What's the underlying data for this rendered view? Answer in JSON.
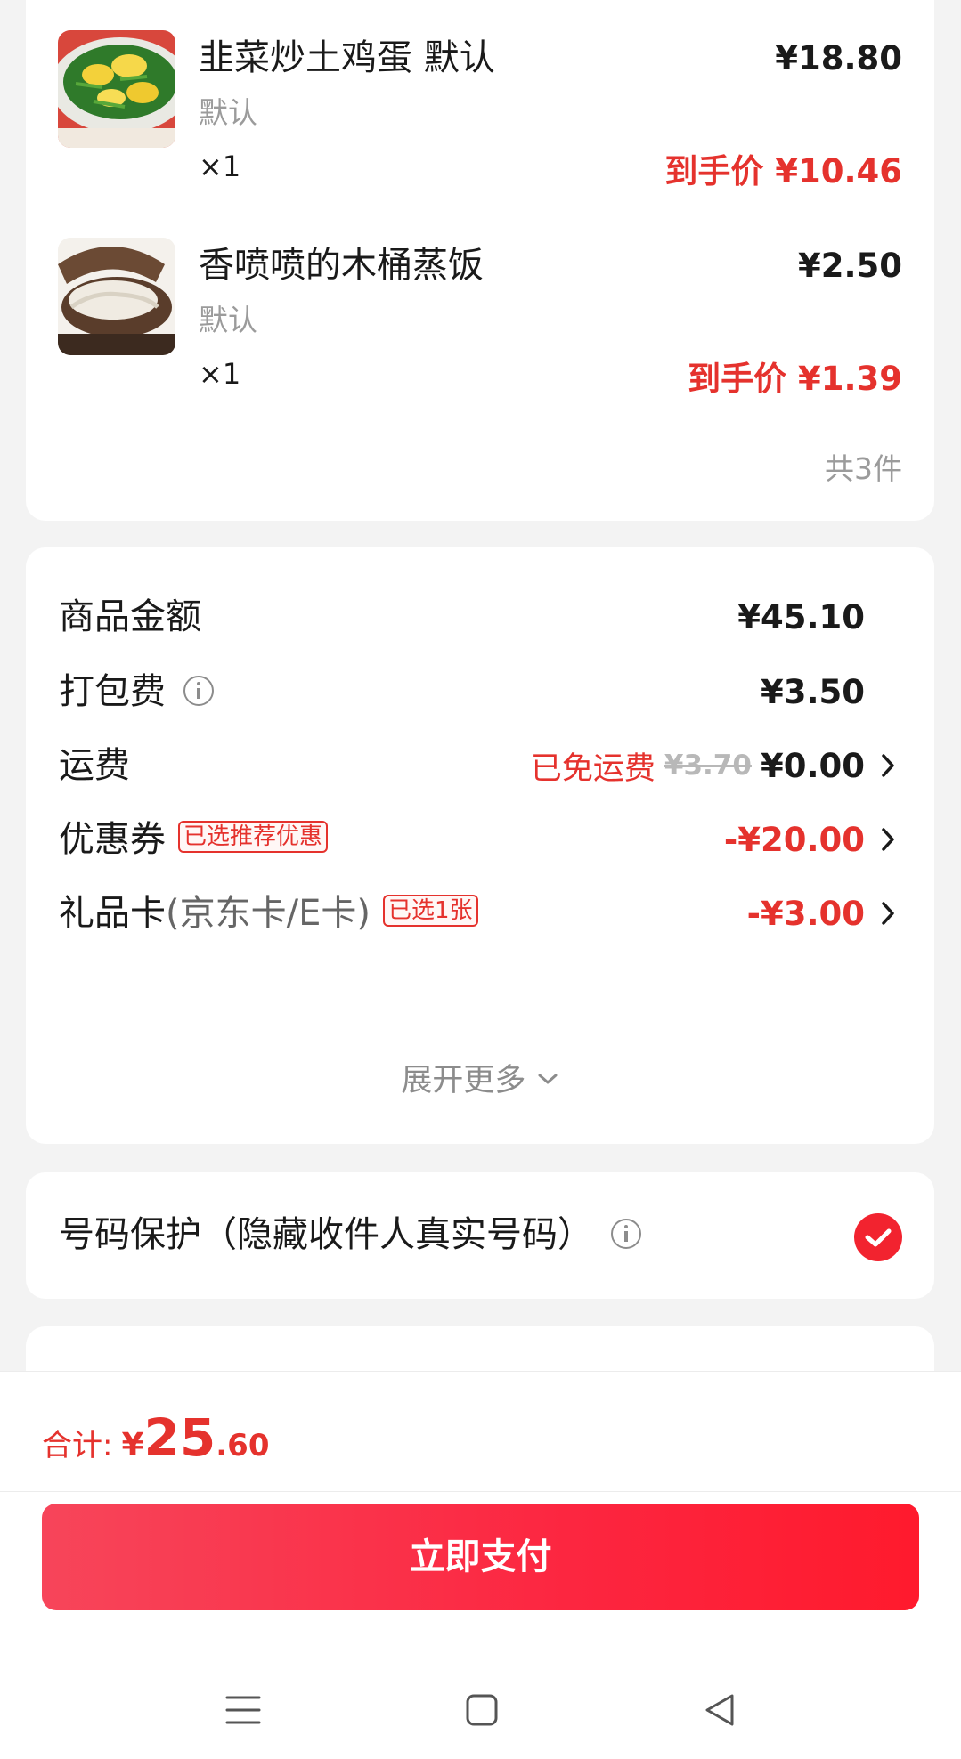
{
  "items": [
    {
      "name": "韭菜炒土鸡蛋 默认",
      "spec": "默认",
      "qty": "×1",
      "price": "¥18.80",
      "final_price": "到手价 ¥10.46"
    },
    {
      "name": "香喷喷的木桶蒸饭",
      "spec": "默认",
      "qty": "×1",
      "price": "¥2.50",
      "final_price": "到手价 ¥1.39"
    }
  ],
  "total_count": "共3件",
  "fees": {
    "goods": {
      "label": "商品金额",
      "amount": "¥45.10"
    },
    "packing": {
      "label": "打包费",
      "amount": "¥3.50"
    },
    "shipping": {
      "label": "运费",
      "free_text": "已免运费",
      "original": "¥3.70",
      "amount": "¥0.00"
    },
    "coupon": {
      "label": "优惠券",
      "tag": "已选推荐优惠",
      "amount": "-¥20.00"
    },
    "giftcard": {
      "label": "礼品卡",
      "sublabel": "(京东卡/E卡)",
      "tag": "已选1张",
      "amount": "-¥3.00"
    },
    "expand_more": "展开更多"
  },
  "privacy": {
    "label": "号码保护（隐藏收件人真实号码）",
    "checked": true
  },
  "footer": {
    "total_label": "合计:",
    "currency": "¥",
    "total_int": "25",
    "total_dec": ".60",
    "pay_button": "立即支付"
  },
  "colors": {
    "accent": "#e5322d",
    "button": "#fc2640"
  },
  "icons": {
    "info": "info-icon",
    "chevron": "chevron-right-icon",
    "check": "check-circle-icon",
    "menu": "menu-icon",
    "home": "home-icon",
    "back": "back-icon"
  }
}
